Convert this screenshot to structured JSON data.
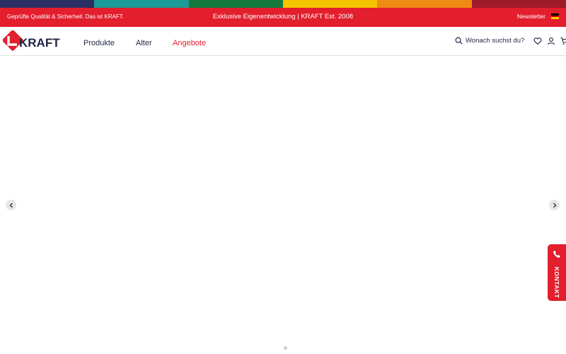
{
  "stripe": {
    "colors": [
      "#2a2f64",
      "#1d9b96",
      "#157a3e",
      "#f5c400",
      "#ef8a12",
      "#9e1b2b"
    ]
  },
  "promo": {
    "left_text": "Geprüfte Qualität & Sicherheit. Das ist KRAFT.",
    "center_text": "Exklusive Eigenentwicklung | KRAFT Est. 2008",
    "newsletter_label": "Newsletter",
    "language_flag_icon": "germany-flag-icon"
  },
  "header": {
    "logo_text": "KRAFT",
    "nav": [
      {
        "label": "Produkte"
      },
      {
        "label": "Alter"
      },
      {
        "label": "Angebote"
      }
    ],
    "search_placeholder": "Wonach suchst du?",
    "icons": [
      "search-icon",
      "heart-icon",
      "user-icon",
      "cart-icon"
    ]
  },
  "slider": {
    "prev_icon": "chevron-left-icon",
    "next_icon": "chevron-right-icon",
    "pagination_dots": 1
  },
  "contact": {
    "label": "KONTAKT",
    "icon": "phone-icon"
  },
  "colors": {
    "brand_red": "#e31e2d",
    "brand_navy": "#1f2444"
  }
}
